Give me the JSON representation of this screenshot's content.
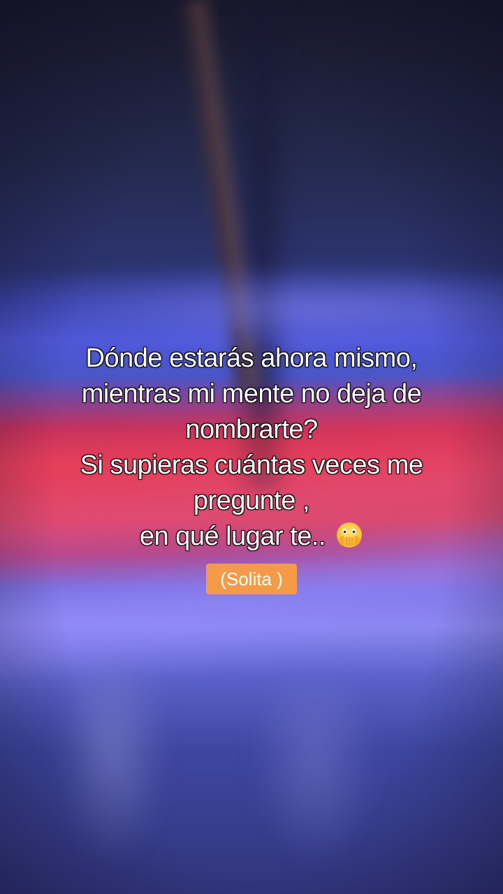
{
  "caption": {
    "lines": [
      "Dónde estarás ahora mismo,",
      "mientras mi mente no deja de",
      "nombrarte?",
      "Si supieras cuántas veces me",
      "pregunte ,",
      "en qué lugar te.."
    ],
    "trailing_emoji": "face-with-open-eyes-and-hand-over-mouth-icon"
  },
  "tag": {
    "label": "(Solita )",
    "color": "#f59a47"
  },
  "background": {
    "description_colors": [
      "#242a4e",
      "#5058d8",
      "#e0405a",
      "#8a88f0",
      "#30347a"
    ]
  }
}
